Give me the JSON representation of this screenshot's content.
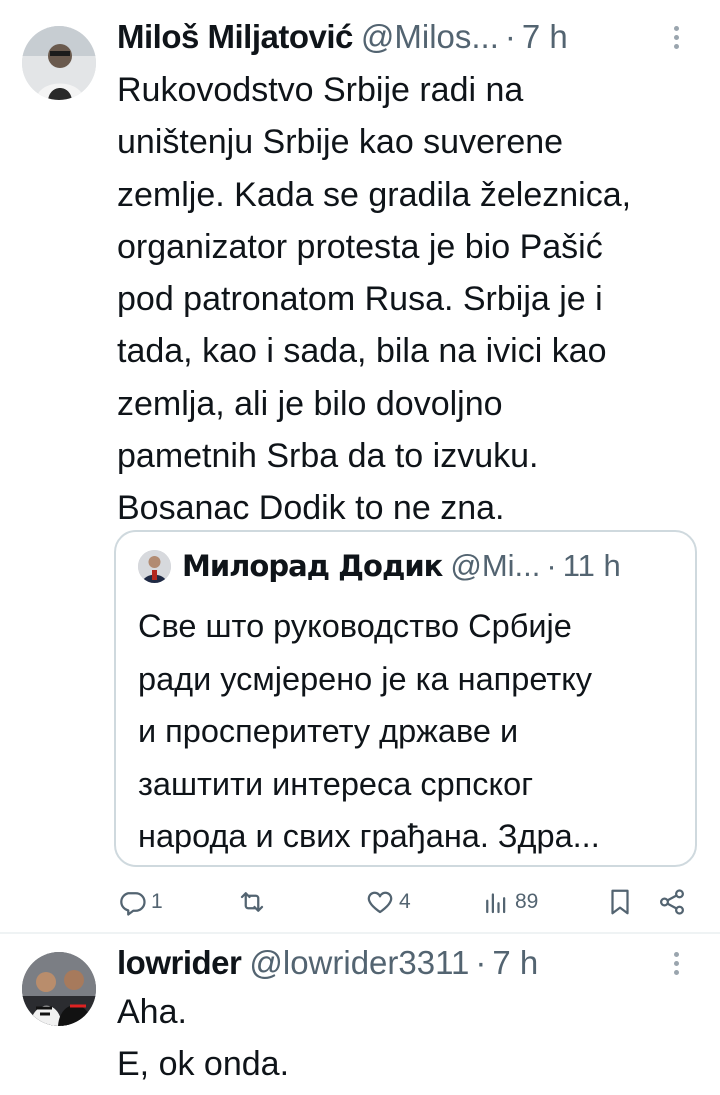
{
  "tweet1": {
    "name": "Miloš Miljatović",
    "handle": "@Milos...",
    "separator": "·",
    "time": "7 h",
    "text_lines": [
      "Rukovodstvo Srbije radi na",
      "uništenju Srbije kao suverene",
      "zemlje. Kada se gradila železnica,",
      "organizator protesta je bio Pašić",
      "pod patronatom Rusa. Srbija je i",
      "tada, kao i sada, bila na ivici kao",
      "zemlja, ali je bilo dovoljno",
      "pametnih Srba da to izvuku.",
      "Bosanac Dodik to ne zna."
    ],
    "quote": {
      "name": "Милорад Додик",
      "handle": "@Mi...",
      "separator": "·",
      "time": "11 h",
      "text_lines": [
        "Све што руководство Србије",
        "ради усмјерено је ка напретку",
        "и просперитету државе и",
        "заштити интереса српског",
        "народа и свих грађана. Здра..."
      ]
    },
    "actions": {
      "replies": "1",
      "retweets": "",
      "likes": "4",
      "views": "89"
    }
  },
  "tweet2": {
    "name": "lowrider",
    "handle": "@lowrider3311",
    "separator": "·",
    "time": "7 h",
    "text_lines": [
      "Aha.",
      "E, ok onda."
    ]
  },
  "icons": {
    "reply": "reply-icon",
    "retweet": "retweet-icon",
    "like": "heart-icon",
    "views": "views-icon",
    "bookmark": "bookmark-icon",
    "share": "share-icon",
    "more": "more-vertical-icon"
  },
  "colors": {
    "text": "#0f1419",
    "secondary": "#536471",
    "border": "#cfd9de"
  }
}
